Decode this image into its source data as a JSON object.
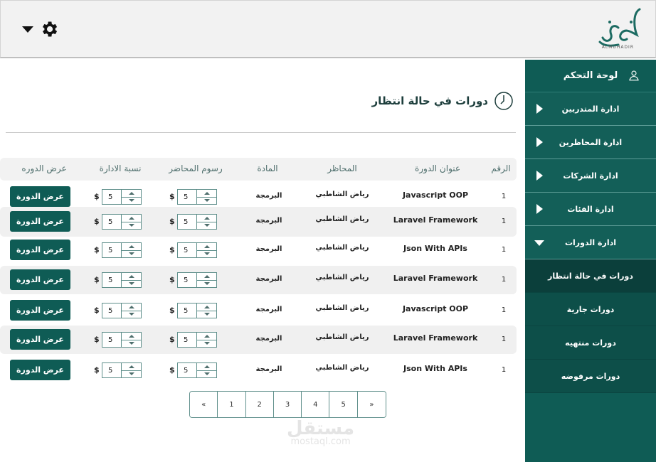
{
  "header": {
    "settings_icon": "gear-icon",
    "logo_caption": "ALMUHADIR"
  },
  "sidebar": {
    "title": "لوحة التحكم",
    "items": [
      {
        "label": "ادارة المتدربين"
      },
      {
        "label": "ادارة المحاظرين"
      },
      {
        "label": "ادارة الشركات"
      },
      {
        "label": "ادارة الفئات"
      },
      {
        "label": "ادارة الدورات"
      }
    ],
    "sub_items": [
      {
        "label": "دورات في حالة انتظار"
      },
      {
        "label": "دورات جارية"
      },
      {
        "label": "دورات منتهيه"
      },
      {
        "label": "دورات مرفوضه"
      }
    ]
  },
  "page": {
    "title": "دورات في حالة انتظار"
  },
  "table": {
    "columns": [
      "الرقم",
      "عنوان الدورة",
      "المحاظر",
      "المادة",
      "رسوم المحاضر",
      "نسبة الادارة",
      "عرض الدوره"
    ],
    "currency": "$",
    "view_label": "عرض الدورة",
    "rows": [
      {
        "num": "1",
        "title": "Javascript OOP",
        "lecturer": "رياض الشاطبي",
        "subject": "البرمجة",
        "fee": "5",
        "ratio": "5"
      },
      {
        "num": "1",
        "title": "Laravel Framework",
        "lecturer": "رياض الشاطبي",
        "subject": "البرمجة",
        "fee": "5",
        "ratio": "5"
      },
      {
        "num": "1",
        "title": "Json With APIs",
        "lecturer": "رياض الشاطبي",
        "subject": "البرمجة",
        "fee": "5",
        "ratio": "5"
      },
      {
        "num": "1",
        "title": "Laravel Framework",
        "lecturer": "رياض الشاطبي",
        "subject": "البرمجة",
        "fee": "5",
        "ratio": "5"
      },
      {
        "num": "1",
        "title": "Javascript OOP",
        "lecturer": "رياض الشاطبي",
        "subject": "البرمجة",
        "fee": "5",
        "ratio": "5"
      },
      {
        "num": "1",
        "title": "Laravel Framework",
        "lecturer": "رياض الشاطبي",
        "subject": "البرمجة",
        "fee": "5",
        "ratio": "5"
      },
      {
        "num": "1",
        "title": "Json With APIs",
        "lecturer": "رياض الشاطبي",
        "subject": "البرمجة",
        "fee": "5",
        "ratio": "5"
      }
    ]
  },
  "pagination": [
    "«",
    "1",
    "2",
    "3",
    "4",
    "5",
    "»"
  ],
  "watermark": {
    "arabic": "مستقل",
    "latin": "mostaql.com"
  },
  "colors": {
    "primary": "#0f5c55",
    "sidebar_active": "#0b3f3b"
  }
}
